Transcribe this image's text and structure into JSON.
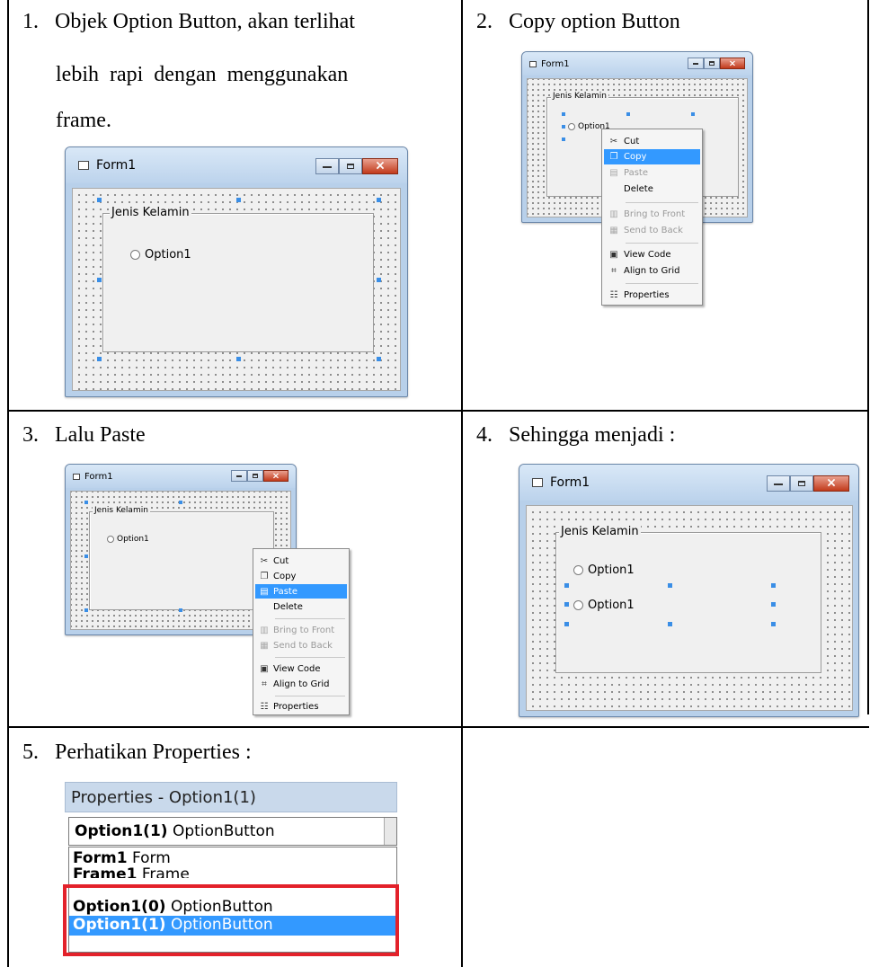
{
  "steps": [
    {
      "number": "1.",
      "lines": [
        "Objek Option Button, akan terlihat",
        "lebih rapi dengan menggunakan",
        "frame."
      ]
    },
    {
      "number": "2.",
      "text": "Copy option Button"
    },
    {
      "number": "3.",
      "text": "Lalu Paste"
    },
    {
      "number": "4.",
      "text": "Sehingga menjadi :"
    },
    {
      "number": "5.",
      "text": "Perhatikan Properties :"
    }
  ],
  "form": {
    "title": "Form1",
    "frame_caption": "Jenis Kelamin",
    "option_label": "Option1"
  },
  "context_menu": {
    "items": [
      "Cut",
      "Copy",
      "Paste",
      "Delete",
      "Bring to Front",
      "Send to Back",
      "View Code",
      "Align to Grid",
      "Properties"
    ]
  },
  "properties_panel": {
    "title": "Properties - Option1(1)",
    "combo_object": "Option1(1)",
    "combo_type": "OptionButton",
    "list": [
      {
        "name": "Form1",
        "type": "Form"
      },
      {
        "name": "Frame1",
        "type": "Frame"
      },
      {
        "name": "Option1(0)",
        "type": "OptionButton"
      },
      {
        "name": "Option1(1)",
        "type": "OptionButton"
      }
    ]
  }
}
